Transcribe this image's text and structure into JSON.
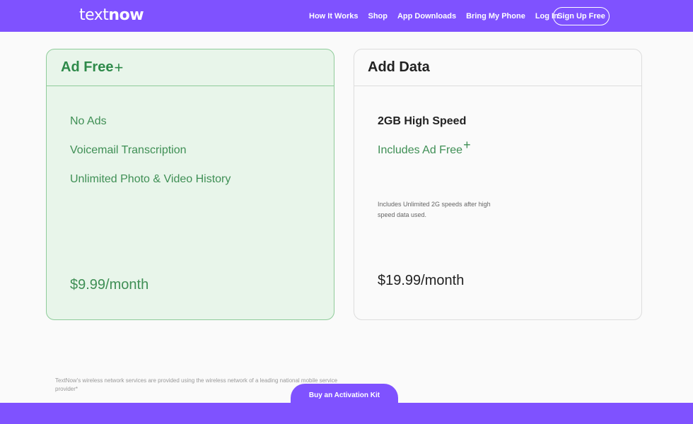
{
  "header": {
    "logo_light": "text",
    "logo_bold": "now",
    "nav": [
      "How It Works",
      "Shop",
      "App Downloads",
      "Bring My Phone",
      "Log In"
    ],
    "signup_label": "Sign Up Free"
  },
  "plans": {
    "adfree": {
      "title": "Ad Free",
      "plus": "+",
      "features": [
        "No Ads",
        "Voicemail Transcription",
        "Unlimited Photo & Video History"
      ],
      "price": "$9.99/month"
    },
    "data": {
      "title": "Add Data",
      "subtitle": "2GB High Speed",
      "includes": "Includes Ad Free",
      "plus": "+",
      "fine_print": "Includes Unlimited 2G speeds after high speed data used.",
      "price": "$19.99/month"
    }
  },
  "footer": {
    "disclaimer": "TextNow's wireless network services are provided using the wireless network of a leading national mobile service provider*",
    "activation_label": "Buy an Activation Kit"
  },
  "colors": {
    "brand_purple": "#7f52ff",
    "accent_green": "#3f8f55"
  }
}
